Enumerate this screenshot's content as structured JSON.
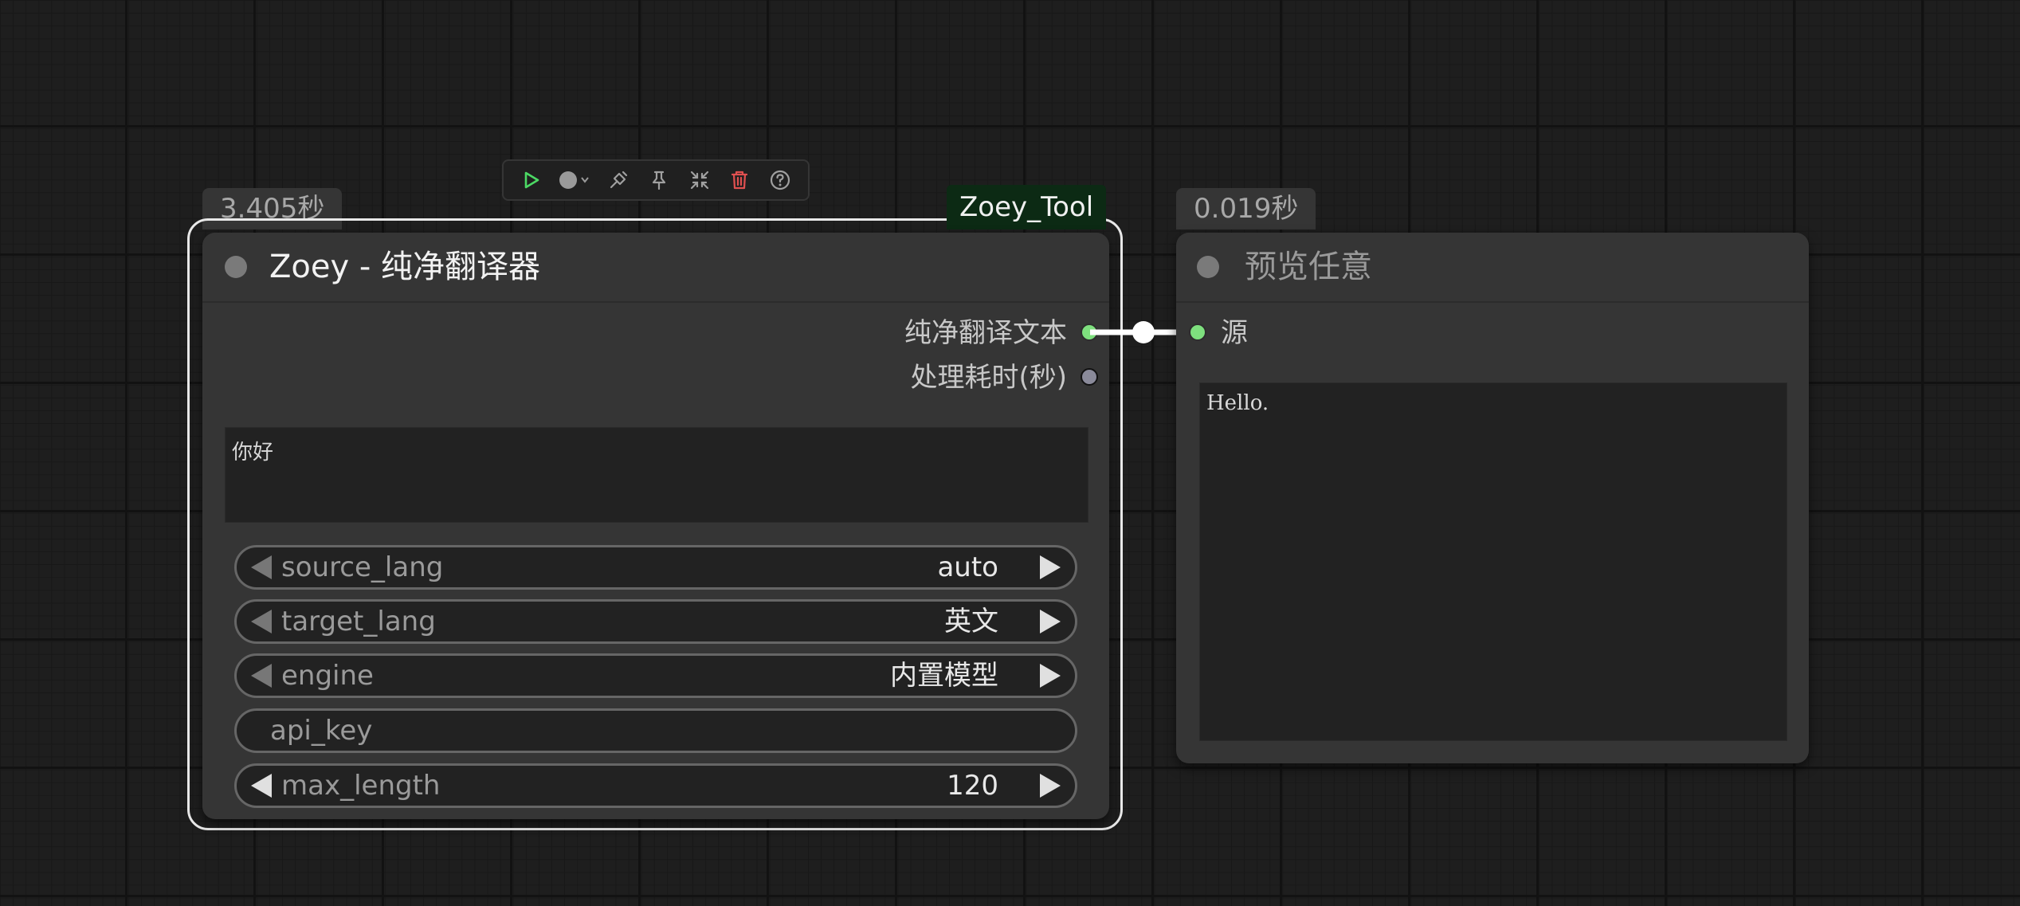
{
  "node_translator": {
    "time_badge": "3.405秒",
    "group_tag": "Zoey_Tool",
    "title": "Zoey - 纯净翻译器",
    "outputs": [
      "纯净翻译文本",
      "处理耗时(秒)"
    ],
    "input_text": "你好",
    "widgets": [
      {
        "name": "source_lang",
        "value": "auto"
      },
      {
        "name": "target_lang",
        "value": "英文"
      },
      {
        "name": "engine",
        "value": "内置模型"
      },
      {
        "name": "api_key",
        "value": ""
      },
      {
        "name": "max_length",
        "value": "120"
      }
    ]
  },
  "node_preview": {
    "time_badge": "0.019秒",
    "title": "预览任意",
    "input_label": "源",
    "preview_text": "Hello."
  },
  "colors": {
    "slot_connected": "#7ee07e",
    "slot_idle": "#8a8a9a",
    "delete_icon": "#e05050",
    "run_icon": "#4cd964",
    "group_tag_bg": "#0c2a14"
  },
  "toolbar_icons": [
    "play-icon",
    "color-dot-icon",
    "bypass-icon",
    "pin-icon",
    "collapse-icon",
    "trash-icon",
    "help-icon"
  ]
}
